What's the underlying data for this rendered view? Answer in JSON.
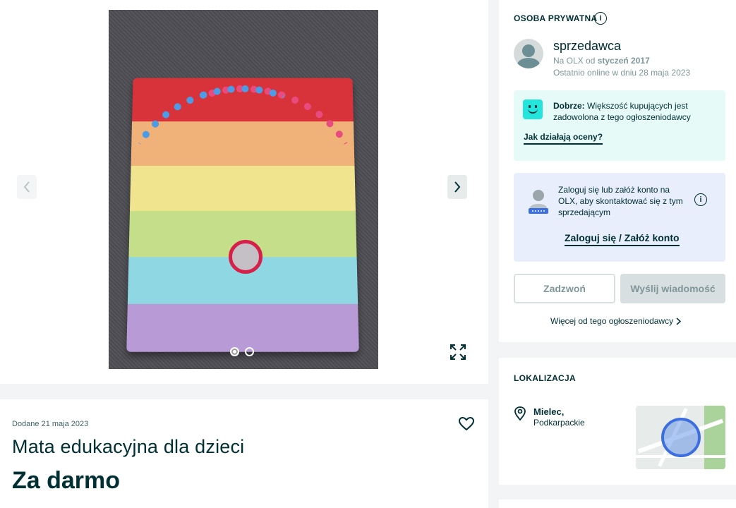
{
  "gallery": {
    "photo_alt": "Mata edukacyjna dla dzieci",
    "total_photos": 2,
    "current_photo": 1,
    "prev_label": "‹",
    "next_label": "›",
    "expand_icon": "expand-icon"
  },
  "ad": {
    "posted": "Dodane 21 maja 2023",
    "title": "Mata edukacyjna dla dzieci",
    "price": "Za darmo",
    "favorite_icon": "heart-icon"
  },
  "seller": {
    "section_label": "OSOBA PRYWATNA",
    "name": "sprzedawca",
    "since_prefix": "Na OLX od ",
    "since_value": "styczeń 2017",
    "last_online": "Ostatnio online w dniu 28 maja 2023",
    "rating": {
      "label_bold": "Dobrze:",
      "label_rest": " Większość kupujących jest zadowolona z tego ogłoszeniodawcy",
      "link": "Jak działają oceny?"
    },
    "login": {
      "text": "Zaloguj się lub załóż konto na OLX, aby skontaktować się z tym sprzedającym",
      "link": "Zaloguj się / Załóż konto"
    },
    "buttons": {
      "call": "Zadzwoń",
      "message": "Wyślij wiadomość"
    },
    "more_link": "Więcej od tego ogłoszeniodawcy"
  },
  "location": {
    "section_label": "LOKALIZACJA",
    "city": "Mielec,",
    "region": "Podkarpackie"
  },
  "colors": {
    "text": "#002f34",
    "muted": "#7f9799",
    "rating_bg": "#e6faf7",
    "login_bg": "#e8eefc",
    "accent": "#23e5db"
  }
}
